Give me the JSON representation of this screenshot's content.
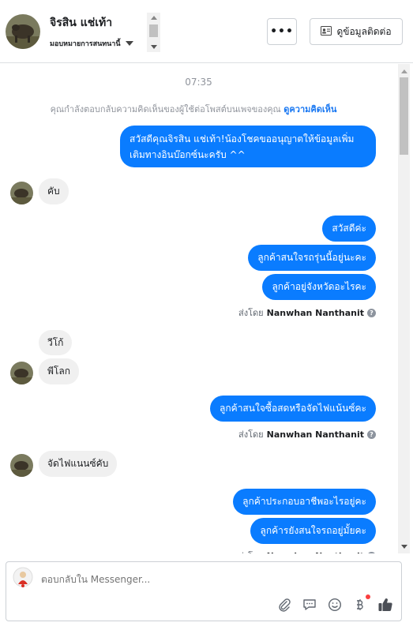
{
  "header": {
    "name": "จิรสิน แช่เท้า",
    "assign_label": "มอบหมายการสนทนานี้",
    "more_label": "•••",
    "contact_label": "ดูข้อมูลติดต่อ"
  },
  "conversation": {
    "timestamp": "07:35",
    "notice_text": "คุณกำลังตอบกลับความคิดเห็นของผู้ใช้ต่อโพสต์บนเพจของคุณ",
    "notice_link": "ดูความคิดเห็น",
    "messages": [
      {
        "dir": "out",
        "text": "สวัสดีคุณจิรสิน แช่เท้า!น้องโชคขออนุญาตให้ข้อมูลเพิ่มเติมทางอินบ๊อกซ์นะครับ ^^"
      },
      {
        "dir": "in",
        "text": "คับ"
      },
      {
        "dir": "out",
        "text": "สวัสดีค่ะ"
      },
      {
        "dir": "out",
        "text": "ลูกค้าสนใจรถรุ่นนี้อยู่นะคะ"
      },
      {
        "dir": "out",
        "text": "ลูกค้าอยู่จังหวัดอะไรคะ"
      },
      {
        "dir": "in",
        "text": "วีโก้"
      },
      {
        "dir": "in",
        "text": "พีโลก"
      },
      {
        "dir": "out",
        "text": "ลูกค้าสนใจซื้อสดหรือจัดไฟแน้นซ์คะ"
      },
      {
        "dir": "in",
        "text": "จัดไฟแนนซ์คับ"
      },
      {
        "dir": "out",
        "text": "ลูกค้าประกอบอาชีพอะไรอยู่คะ"
      },
      {
        "dir": "out",
        "text": "ลูกค้ารยังสนใจรถอยู่มั้ยคะ"
      }
    ],
    "sent_by_prefix": "ส่งโดย",
    "sent_by_name": "Nanwhan Nanthanit"
  },
  "composer": {
    "placeholder": "ตอบกลับใน Messenger..."
  },
  "colors": {
    "outgoing_bubble": "#0a7cff",
    "incoming_bubble": "#f0f0f0",
    "link": "#1877f2"
  }
}
